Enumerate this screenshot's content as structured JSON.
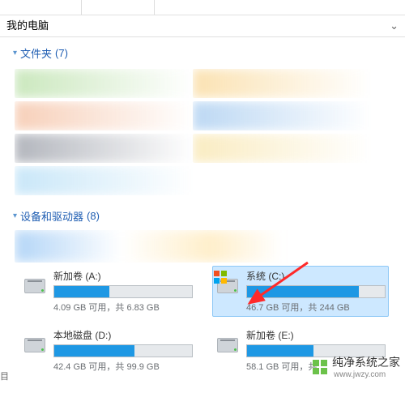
{
  "location": {
    "title": "我的电脑"
  },
  "groups": {
    "folders": {
      "label": "文件夹",
      "count": "(7)"
    },
    "devices": {
      "label": "设备和驱动器",
      "count": "(8)"
    }
  },
  "drives": [
    {
      "name": "新加卷 (A:)",
      "free": "4.09 GB 可用，共 6.83 GB",
      "fill": 40,
      "selected": false,
      "win": false
    },
    {
      "name": "系统 (C:)",
      "free": "46.7 GB 可用，共 244 GB",
      "fill": 81,
      "selected": true,
      "win": true
    },
    {
      "name": "本地磁盘 (D:)",
      "free": "42.4 GB 可用，共 99.9 GB",
      "fill": 58,
      "selected": false,
      "win": false
    },
    {
      "name": "新加卷 (E:)",
      "free": "58.1 GB 可用，共",
      "fill": 48,
      "selected": false,
      "win": false
    }
  ],
  "watermark": {
    "text": "纯净系统之家",
    "url": "www.jwzy.com"
  }
}
